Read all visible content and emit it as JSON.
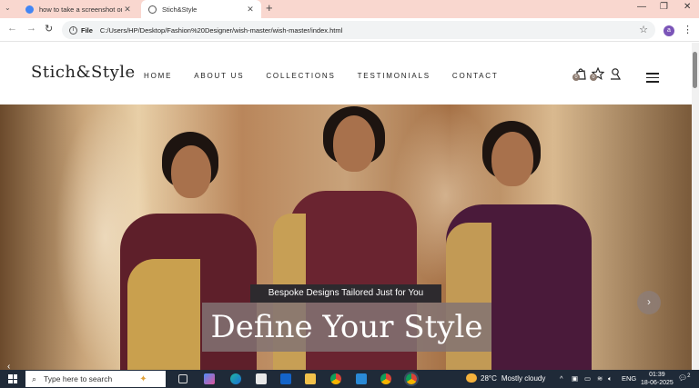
{
  "browser": {
    "tabs": [
      {
        "title": "how to take a screenshot on w",
        "active": false
      },
      {
        "title": "Stich&Style",
        "active": true
      }
    ],
    "address": {
      "scheme_label": "File",
      "url": "C:/Users/HP/Desktop/Fashion%20Designer/wish-master/wish-master/index.html"
    },
    "profile_initial": "a"
  },
  "site": {
    "logo": "Stich&Style",
    "nav": [
      "HOME",
      "ABOUT US",
      "COLLECTIONS",
      "TESTIMONIALS",
      "CONTACT"
    ],
    "cart_count": "0",
    "wishlist_count": "0"
  },
  "hero": {
    "subtitle": "Bespoke Designs Tailored Just for You",
    "title": "Define Your Style",
    "prev_glyph": "‹",
    "next_glyph": "›"
  },
  "taskbar": {
    "search_placeholder": "Type here to search",
    "weather": {
      "temp": "28°C",
      "condition": "Mostly cloudy"
    },
    "language": "ENG",
    "time": "01:39",
    "date": "18-06-2025",
    "notifications": "2"
  },
  "colors": {
    "tab_strip": "#f9d7cf",
    "taskbar": "#1f2a38",
    "title_box": "#827373",
    "subtitle_box": "#2d2a2e"
  }
}
